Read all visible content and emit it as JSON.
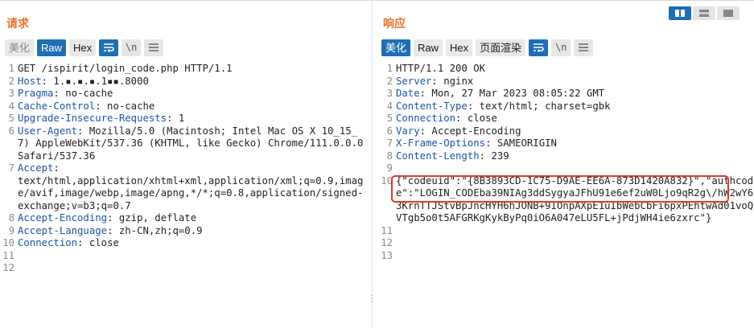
{
  "request": {
    "title": "请求",
    "toolbar": {
      "pretty": "美化",
      "raw": "Raw",
      "hex": "Hex",
      "newline": "\\n"
    },
    "lines": [
      {
        "n": "1",
        "text": "GET /ispirit/login_code.php HTTP/1.1"
      },
      {
        "n": "2",
        "key": "Host",
        "value": " 1.▪.▪.▪.1▪▪.8000"
      },
      {
        "n": "3",
        "key": "Pragma",
        "value": " no-cache"
      },
      {
        "n": "4",
        "key": "Cache-Control",
        "value": " no-cache"
      },
      {
        "n": "5",
        "key": "Upgrade-Insecure-Requests",
        "value": " 1"
      },
      {
        "n": "6",
        "key": "User-Agent",
        "value": " Mozilla/5.0 (Macintosh; Intel Mac OS X 10_15_7) AppleWebKit/537.36 (KHTML, like Gecko) Chrome/111.0.0.0 Safari/537.36"
      },
      {
        "n": "7",
        "key": "Accept",
        "value": "\ntext/html,application/xhtml+xml,application/xml;q=0.9,image/avif,image/webp,image/apng,*/*;q=0.8,application/signed-exchange;v=b3;q=0.7"
      },
      {
        "n": "8",
        "key": "Accept-Encoding",
        "value": " gzip, deflate"
      },
      {
        "n": "9",
        "key": "Accept-Language",
        "value": " zh-CN,zh;q=0.9"
      },
      {
        "n": "10",
        "key": "Connection",
        "value": " close"
      },
      {
        "n": "11",
        "text": ""
      },
      {
        "n": "12",
        "text": ""
      }
    ]
  },
  "response": {
    "title": "响应",
    "toolbar": {
      "pretty": "美化",
      "raw": "Raw",
      "hex": "Hex",
      "render": "页面渲染",
      "newline": "\\n"
    },
    "lines": [
      {
        "n": "1",
        "text": "HTTP/1.1 200 OK"
      },
      {
        "n": "2",
        "key": "Server",
        "value": " nginx"
      },
      {
        "n": "3",
        "key": "Date",
        "value": " Mon, 27 Mar 2023 08:05:22 GMT"
      },
      {
        "n": "4",
        "key": "Content-Type",
        "value": " text/html; charset=gbk"
      },
      {
        "n": "5",
        "key": "Connection",
        "value": " close"
      },
      {
        "n": "6",
        "key": "Vary",
        "value": " Accept-Encoding"
      },
      {
        "n": "7",
        "key": "X-Frame-Options",
        "value": " SAMEORIGIN"
      },
      {
        "n": "8",
        "key": "Content-Length",
        "value": " 239"
      },
      {
        "n": "9",
        "text": ""
      },
      {
        "n": "10",
        "text": "{\"codeuid\":\"{8B3893CD-1C75-D9AE-EE6A-873D1420A832}\",\"authcode\":\"LOGIN_CODEba39NIAg3ddSygyaJFhU91e6ef2uW0Ljo9qR2g\\/hW2wY63KrnTTJStvBpJncHYH6hJONB+9IOnpAXpE1uIbWebCbFi6pxPEhtwAd01voQVTgb5o0t5AFGRKgKykByPq0iO6A047eLU5FL+jPdjWH4ie6zxrc\"}"
      },
      {
        "n": "11",
        "text": ""
      },
      {
        "n": "12",
        "text": ""
      },
      {
        "n": "13",
        "text": ""
      }
    ]
  },
  "colors": {
    "accent": "#1e6fb8",
    "title": "#e8702a",
    "header_key": "#1a53a6",
    "highlight": "#e03a2f"
  },
  "icons": [
    "wrap-lines-icon",
    "menu-icon",
    "split-view-icon",
    "horizontal-view-icon",
    "single-view-icon"
  ]
}
